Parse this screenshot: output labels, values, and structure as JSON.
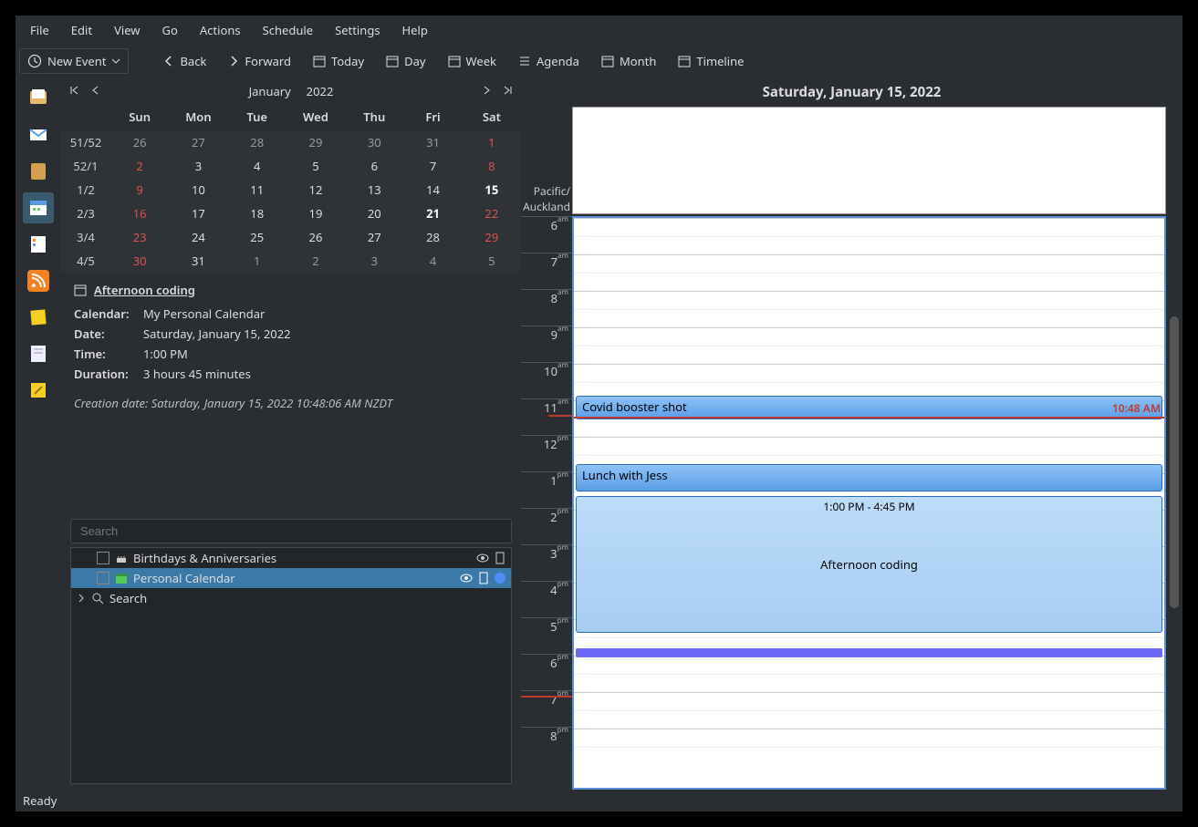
{
  "menubar": [
    "File",
    "Edit",
    "View",
    "Go",
    "Actions",
    "Schedule",
    "Settings",
    "Help"
  ],
  "toolbar": {
    "new_event": "New Event",
    "back": "Back",
    "forward": "Forward",
    "today": "Today",
    "day": "Day",
    "week": "Week",
    "agenda": "Agenda",
    "month": "Month",
    "timeline": "Timeline"
  },
  "datepicker": {
    "month": "January",
    "year": "2022",
    "dow": [
      "Sun",
      "Mon",
      "Tue",
      "Wed",
      "Thu",
      "Fri",
      "Sat"
    ],
    "rows": [
      {
        "wk": "51/52",
        "days": [
          {
            "d": "26",
            "dim": true
          },
          {
            "d": "27",
            "dim": true
          },
          {
            "d": "28",
            "dim": true
          },
          {
            "d": "29",
            "dim": true
          },
          {
            "d": "30",
            "dim": true
          },
          {
            "d": "31",
            "dim": true
          },
          {
            "d": "1",
            "red": true
          }
        ]
      },
      {
        "wk": "52/1",
        "days": [
          {
            "d": "2",
            "red": true
          },
          {
            "d": "3"
          },
          {
            "d": "4"
          },
          {
            "d": "5"
          },
          {
            "d": "6"
          },
          {
            "d": "7"
          },
          {
            "d": "8",
            "red": true
          }
        ]
      },
      {
        "wk": "1/2",
        "days": [
          {
            "d": "9",
            "red": true
          },
          {
            "d": "10"
          },
          {
            "d": "11"
          },
          {
            "d": "12"
          },
          {
            "d": "13"
          },
          {
            "d": "14"
          },
          {
            "d": "15",
            "selected": true
          }
        ]
      },
      {
        "wk": "2/3",
        "days": [
          {
            "d": "16",
            "red": true
          },
          {
            "d": "17"
          },
          {
            "d": "18"
          },
          {
            "d": "19"
          },
          {
            "d": "20"
          },
          {
            "d": "21",
            "bold": true
          },
          {
            "d": "22",
            "red": true
          }
        ]
      },
      {
        "wk": "3/4",
        "days": [
          {
            "d": "23",
            "red": true
          },
          {
            "d": "24"
          },
          {
            "d": "25"
          },
          {
            "d": "26"
          },
          {
            "d": "27"
          },
          {
            "d": "28"
          },
          {
            "d": "29",
            "red": true
          }
        ]
      },
      {
        "wk": "4/5",
        "days": [
          {
            "d": "30",
            "red": true
          },
          {
            "d": "31"
          },
          {
            "d": "1",
            "dim": true
          },
          {
            "d": "2",
            "dim": true
          },
          {
            "d": "3",
            "dim": true
          },
          {
            "d": "4",
            "dim": true
          },
          {
            "d": "5",
            "dim": true
          }
        ]
      }
    ]
  },
  "event_detail": {
    "title": "Afternoon coding",
    "calendar_label": "Calendar:",
    "calendar": "My Personal Calendar",
    "date_label": "Date:",
    "date": "Saturday, January 15, 2022",
    "time_label": "Time:",
    "time": "1:00 PM",
    "duration_label": "Duration:",
    "duration": "3 hours 45 minutes",
    "creation": "Creation date: Saturday, January 15, 2022 10:48:06 AM NZDT"
  },
  "search": {
    "placeholder": "Search"
  },
  "calendars": {
    "birthdays": "Birthdays & Anniversaries",
    "personal": "Personal Calendar",
    "search": "Search"
  },
  "day_view": {
    "title": "Saturday, January 15, 2022",
    "tz": "Pacific/\nAuckland",
    "hours": [
      {
        "h": "6",
        "ap": "am"
      },
      {
        "h": "7",
        "ap": "am"
      },
      {
        "h": "8",
        "ap": "am"
      },
      {
        "h": "9",
        "ap": "am"
      },
      {
        "h": "10",
        "ap": "am"
      },
      {
        "h": "11",
        "ap": "am"
      },
      {
        "h": "12",
        "ap": "pm"
      },
      {
        "h": "1",
        "ap": "pm"
      },
      {
        "h": "2",
        "ap": "pm"
      },
      {
        "h": "3",
        "ap": "pm"
      },
      {
        "h": "4",
        "ap": "pm"
      },
      {
        "h": "5",
        "ap": "pm"
      },
      {
        "h": "6",
        "ap": "pm"
      },
      {
        "h": "7",
        "ap": "pm"
      },
      {
        "h": "8",
        "ap": "pm"
      }
    ],
    "now": "10:48 AM",
    "events": {
      "covid": "Covid booster shot",
      "lunch": "Lunch with Jess",
      "coding_time": "1:00 PM - 4:45 PM",
      "coding": "Afternoon coding"
    }
  },
  "status": "Ready"
}
